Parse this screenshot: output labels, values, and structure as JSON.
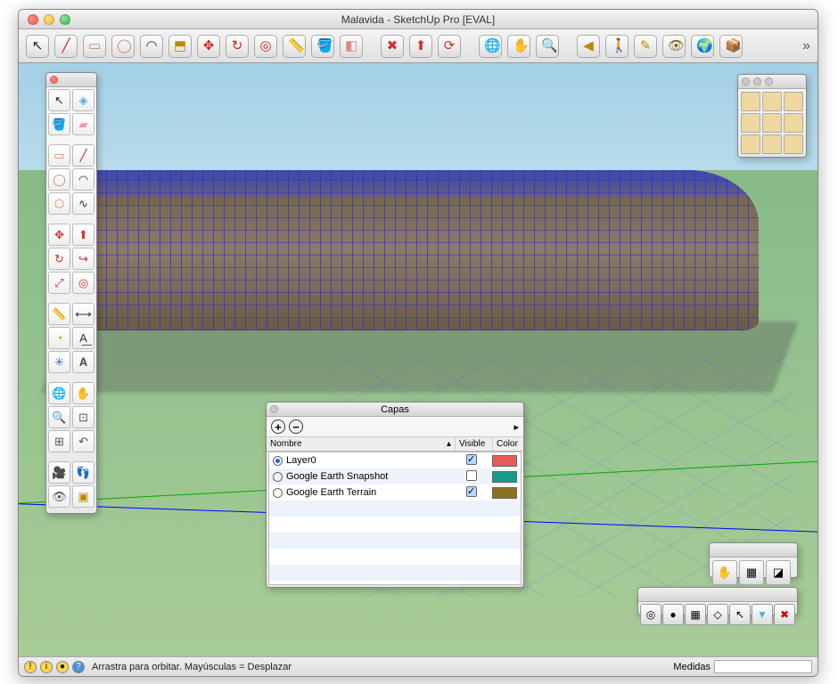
{
  "window": {
    "title": "Malavida - SketchUp Pro [EVAL]"
  },
  "toolbar": {
    "tools": [
      {
        "name": "select-tool",
        "glyph": "↖",
        "col": "#222"
      },
      {
        "name": "line-tool",
        "glyph": "╱",
        "col": "#c22"
      },
      {
        "name": "rectangle-tool",
        "glyph": "▭",
        "col": "#c86"
      },
      {
        "name": "circle-tool",
        "glyph": "◯",
        "col": "#c86"
      },
      {
        "name": "arc-tool",
        "glyph": "◠",
        "col": "#333"
      },
      {
        "name": "pushpull-tool",
        "glyph": "⬒",
        "col": "#b80"
      },
      {
        "name": "move-tool",
        "glyph": "✥",
        "col": "#c22"
      },
      {
        "name": "rotate-tool",
        "glyph": "↻",
        "col": "#c22"
      },
      {
        "name": "offset-tool",
        "glyph": "◎",
        "col": "#c22"
      },
      {
        "name": "tape-tool",
        "glyph": "📏",
        "col": "#b80"
      },
      {
        "name": "paint-tool",
        "glyph": "🪣",
        "col": "#b80"
      },
      {
        "name": "eraser-tool",
        "glyph": "◧",
        "col": "#d88"
      }
    ],
    "tools2": [
      {
        "name": "make-component",
        "glyph": "✖",
        "col": "#c33"
      },
      {
        "name": "scale-tool",
        "glyph": "⬆",
        "col": "#c33"
      },
      {
        "name": "refresh-tool",
        "glyph": "⟳",
        "col": "#c33"
      }
    ],
    "tools3": [
      {
        "name": "orbit-tool",
        "glyph": "🌐",
        "col": "#36c"
      },
      {
        "name": "pan-tool",
        "glyph": "✋",
        "col": "#ca8"
      },
      {
        "name": "zoom-tool",
        "glyph": "🔍",
        "col": "#555"
      }
    ],
    "tools4": [
      {
        "name": "camera-prev",
        "glyph": "◀",
        "col": "#b80"
      },
      {
        "name": "walk-tool",
        "glyph": "🚶",
        "col": "#862"
      },
      {
        "name": "section-tool",
        "glyph": "✎",
        "col": "#b80"
      },
      {
        "name": "look-tool",
        "glyph": "👁",
        "col": "#862"
      },
      {
        "name": "earth-tool",
        "glyph": "🌍",
        "col": "#36a"
      },
      {
        "name": "export-tool",
        "glyph": "📦",
        "col": "#888"
      }
    ]
  },
  "leftpanel": {
    "rows": [
      [
        {
          "n": "select",
          "g": "↖",
          "c": "#222"
        },
        {
          "n": "component",
          "g": "◈",
          "c": "#5ad"
        }
      ],
      [
        {
          "n": "paint",
          "g": "🪣",
          "c": "#c90"
        },
        {
          "n": "eraser",
          "g": "▰",
          "c": "#e9a"
        }
      ],
      [
        {
          "n": "rect",
          "g": "▭",
          "c": "#c86"
        },
        {
          "n": "line",
          "g": "╱",
          "c": "#c22"
        }
      ],
      [
        {
          "n": "circle",
          "g": "◯",
          "c": "#c86"
        },
        {
          "n": "arc",
          "g": "◠",
          "c": "#333"
        }
      ],
      [
        {
          "n": "polygon",
          "g": "⬡",
          "c": "#c86"
        },
        {
          "n": "freehand",
          "g": "∿",
          "c": "#333"
        }
      ],
      [
        {
          "n": "move",
          "g": "✥",
          "c": "#c33"
        },
        {
          "n": "pushpull",
          "g": "⬆",
          "c": "#c33"
        }
      ],
      [
        {
          "n": "rotate",
          "g": "↻",
          "c": "#c33"
        },
        {
          "n": "followme",
          "g": "↪",
          "c": "#c33"
        }
      ],
      [
        {
          "n": "scale",
          "g": "⤢",
          "c": "#c33"
        },
        {
          "n": "offset",
          "g": "◎",
          "c": "#c33"
        }
      ],
      [
        {
          "n": "tape",
          "g": "📏",
          "c": "#c90"
        },
        {
          "n": "dimension",
          "g": "⟷",
          "c": "#333"
        }
      ],
      [
        {
          "n": "protractor",
          "g": "◔",
          "c": "#c90"
        },
        {
          "n": "text",
          "g": "A͟",
          "c": "#333"
        }
      ],
      [
        {
          "n": "axes",
          "g": "✳",
          "c": "#36c"
        },
        {
          "n": "3dtext",
          "g": "𝐀",
          "c": "#555"
        }
      ],
      [
        {
          "n": "orbit",
          "g": "🌐",
          "c": "#36c"
        },
        {
          "n": "pan",
          "g": "✋",
          "c": "#ca8"
        }
      ],
      [
        {
          "n": "zoom",
          "g": "🔍",
          "c": "#555"
        },
        {
          "n": "zoomwin",
          "g": "⊡",
          "c": "#555"
        }
      ],
      [
        {
          "n": "zoomext",
          "g": "⊞",
          "c": "#555"
        },
        {
          "n": "prev",
          "g": "↶",
          "c": "#555"
        }
      ],
      [
        {
          "n": "position",
          "g": "🎥",
          "c": "#555"
        },
        {
          "n": "walk",
          "g": "👣",
          "c": "#333"
        }
      ],
      [
        {
          "n": "look",
          "g": "👁",
          "c": "#555"
        },
        {
          "n": "section",
          "g": "▣",
          "c": "#b80"
        }
      ]
    ]
  },
  "stylepanel": {
    "styles": [
      "style-1",
      "style-2",
      "style-3",
      "style-4",
      "style-5",
      "style-6",
      "style-7",
      "style-8",
      "style-9"
    ]
  },
  "layers": {
    "title": "Capas",
    "add_icon": "+",
    "remove_icon": "−",
    "menu_icon": "▸",
    "col_name": "Nombre",
    "col_visible": "Visible",
    "col_color": "Color",
    "rows": [
      {
        "name": "Layer0",
        "selected": true,
        "visible": true,
        "color": "#e85a5a"
      },
      {
        "name": "Google Earth Snapshot",
        "selected": false,
        "visible": false,
        "color": "#1a9988"
      },
      {
        "name": "Google Earth Terrain",
        "selected": false,
        "visible": true,
        "color": "#8a7020"
      }
    ]
  },
  "dragpanel": {
    "btns": [
      {
        "n": "pan",
        "g": "✋"
      },
      {
        "n": "texture",
        "g": "▦"
      },
      {
        "n": "pushpull",
        "g": "◪"
      }
    ]
  },
  "btmpanel": {
    "btns": [
      {
        "n": "target",
        "g": "◎"
      },
      {
        "n": "globe",
        "g": "●"
      },
      {
        "n": "grid",
        "g": "▦"
      },
      {
        "n": "nav",
        "g": "◇"
      },
      {
        "n": "cursor",
        "g": "↖"
      },
      {
        "n": "cut",
        "g": "▼"
      },
      {
        "n": "close",
        "g": "✖"
      }
    ]
  },
  "status": {
    "hint": "Arrastra para orbitar. Mayúsculas = Desplazar",
    "measure_label": "Medidas"
  }
}
